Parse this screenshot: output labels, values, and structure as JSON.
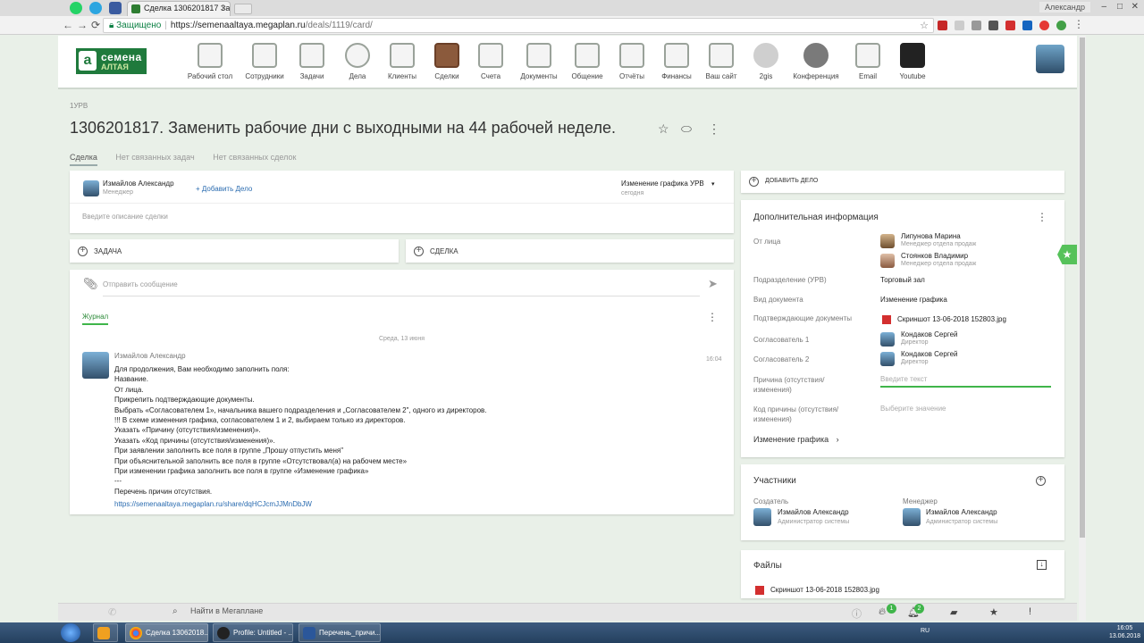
{
  "browser": {
    "tab_title": "Сделка 1306201817 Зам",
    "user_label": "Александр",
    "secure_label": "Защищено",
    "url_host": "https://semenaaltaya.megaplan.ru",
    "url_path": "/deals/1119/card/"
  },
  "app": {
    "logo_line1": "семена",
    "logo_line2": "АЛТАЯ",
    "nav": [
      {
        "label": "Рабочий стол",
        "icon": "desktop-icon"
      },
      {
        "label": "Сотрудники",
        "icon": "employees-icon"
      },
      {
        "label": "Задачи",
        "icon": "tasks-icon"
      },
      {
        "label": "Дела",
        "icon": "clock-icon"
      },
      {
        "label": "Клиенты",
        "icon": "clients-icon"
      },
      {
        "label": "Сделки",
        "icon": "briefcase-icon"
      },
      {
        "label": "Счета",
        "icon": "invoice-icon"
      },
      {
        "label": "Документы",
        "icon": "documents-icon"
      },
      {
        "label": "Общение",
        "icon": "chat-icon"
      },
      {
        "label": "Отчёты",
        "icon": "reports-icon"
      },
      {
        "label": "Финансы",
        "icon": "safe-icon"
      },
      {
        "label": "Ваш сайт",
        "icon": "site-icon"
      },
      {
        "label": "2gis",
        "icon": "2gis-icon"
      },
      {
        "label": "Конференция",
        "icon": "conference-icon"
      },
      {
        "label": "Email",
        "icon": "email-icon"
      },
      {
        "label": "Youtube",
        "icon": "youtube-icon"
      }
    ]
  },
  "deal": {
    "breadcrumb": "1УРВ",
    "title": "1306201817. Заменить рабочие дни с выходными на 44 рабочей неделе.",
    "tabs": {
      "active": "Сделка",
      "tasks": "Нет связанных задач",
      "deals": "Нет связанных сделок"
    },
    "owner_name": "Измайлов Александр",
    "owner_role": "Менеджер",
    "add_case": "+ Добавить Дело",
    "stage": "Изменение графика УРВ",
    "stage_date": "сегодня",
    "description_placeholder": "Введите описание сделки",
    "task_button": "ЗАДАЧА",
    "deal_button": "СДЕЛКА",
    "message_placeholder": "Отправить сообщение",
    "journal_tab": "Журнал",
    "date_separator": "Среда, 13 июня",
    "post": {
      "author": "Измайлов Александр",
      "time": "16:04",
      "lines": [
        "Для продолжения, Вам необходимо заполнить поля:",
        "Название.",
        "От лица.",
        "Прикрепить подтверждающие документы.",
        "Выбрать «Согласователем 1», начальника вашего подразделения и „Согласователем 2\", одного из директоров.",
        "!!! В схеме изменения графика, согласователем 1 и 2, выбираем только из директоров.",
        "Указать «Причину (отсутствия/изменения)».",
        "Указать «Код причины (отсутствия/изменения)».",
        "При заявлении заполнить все поля в группе „Прошу отпустить меня\"",
        "При объяснительной заполнить все поля в группе «Отсутствовал(а) на рабочем месте»",
        "При изменении графика заполнить все поля в группе «Изменение графика»",
        "---",
        "Перечень причин отсутствия."
      ],
      "link": "https://semenaaltaya.megaplan.ru/share/dqHCJcmJJMnDbJW"
    }
  },
  "side": {
    "add_case": "ДОБАВИТЬ ДЕЛО",
    "info_title": "Дополнительная информация",
    "from_label": "От лица",
    "from": [
      {
        "name": "Липунова Марина",
        "role": "Менеджер отдела продаж"
      },
      {
        "name": "Стоянков Владимир",
        "role": "Менеджер отдела продаж"
      }
    ],
    "division_label": "Подразделение (УРВ)",
    "division_value": "Торговый зал",
    "doctype_label": "Вид документа",
    "doctype_value": "Изменение графика",
    "docs_label": "Подтверждающие документы",
    "docs_value": "Скриншот 13-06-2018 152803.jpg",
    "approver1_label": "Согласователь 1",
    "approver1_name": "Кондаков Сергей",
    "approver1_role": "Директор",
    "approver2_label": "Согласователь 2",
    "approver2_name": "Кондаков Сергей",
    "approver2_role": "Директор",
    "reason_label": "Причина (отсутствия/ изменения)",
    "reason_placeholder": "Введите текст",
    "code_label": "Код причины (отсутствия/ изменения)",
    "code_placeholder": "Выберите значение",
    "group_link": "Изменение графика",
    "participants_title": "Участники",
    "creator_label": "Создатель",
    "creator_name": "Измайлов Александр",
    "creator_role": "Администратор системы",
    "manager_label": "Менеджер",
    "manager_name": "Измайлов Александр",
    "manager_role": "Администратор системы",
    "files_title": "Файлы",
    "file_name": "Скриншот 13-06-2018 152803.jpg"
  },
  "footer": {
    "search_placeholder": "Найти в Мегаплане",
    "badge_fire": "1",
    "badge_bell": "2"
  },
  "taskbar": {
    "items": [
      "Сделка 13062018...",
      "Profile: Untitled - ...",
      "Перечень_причи..."
    ],
    "lang": "RU",
    "time": "16:05",
    "date": "13.06.2018"
  }
}
